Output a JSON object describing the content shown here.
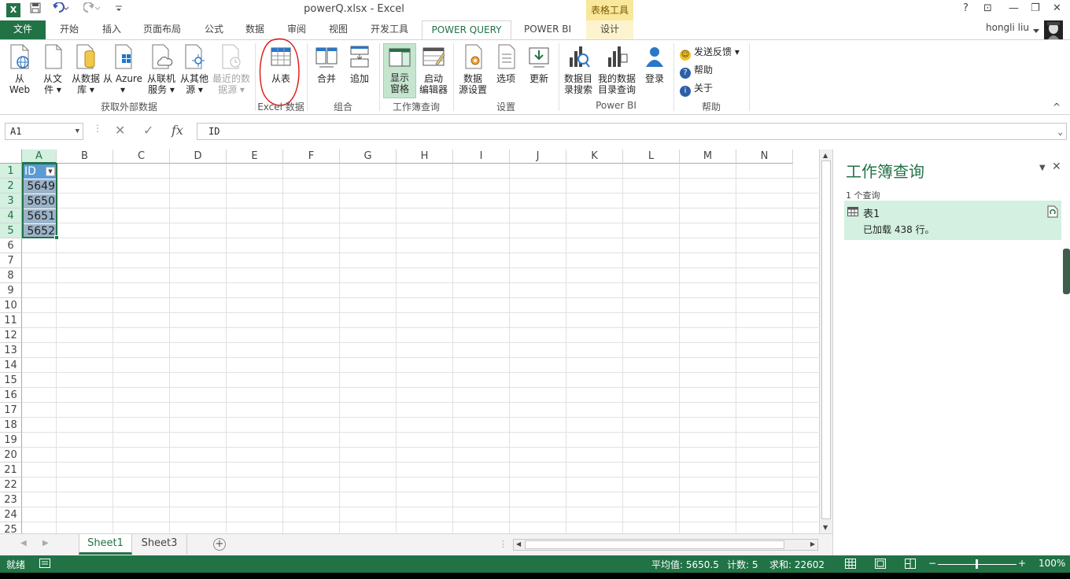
{
  "titlebar": {
    "logo": "X",
    "title": "powerQ.xlsx - Excel",
    "context_tab_group": "表格工具",
    "help": "?",
    "restore_ribbon": "⊡",
    "minimize": "—",
    "maximize": "❐",
    "close": "✕"
  },
  "tabs": {
    "file": "文件",
    "home": "开始",
    "insert": "插入",
    "page_layout": "页面布局",
    "formulas": "公式",
    "data": "数据",
    "review": "审阅",
    "view": "视图",
    "developer": "开发工具",
    "power_query": "POWER QUERY",
    "power_bi": "POWER BI",
    "design": "设计",
    "user": "hongli liu"
  },
  "ribbon": {
    "from_web": [
      "从",
      "Web"
    ],
    "from_file": [
      "从文",
      "件 ▾"
    ],
    "from_database": [
      "从数据",
      "库 ▾"
    ],
    "from_azure": [
      "从 Azure",
      "▾"
    ],
    "from_online_services": [
      "从联机",
      "服务 ▾"
    ],
    "from_other_sources": [
      "从其他",
      "源 ▾"
    ],
    "recent_sources": [
      "最近的数",
      "据源 ▾"
    ],
    "group_external": "获取外部数据",
    "from_table": "从表",
    "group_excel": "Excel 数据",
    "merge": "合并",
    "append": "追加",
    "group_combine": "组合",
    "show_pane": [
      "显示",
      "窗格"
    ],
    "launch_editor": [
      "启动",
      "编辑器"
    ],
    "group_workbook_queries": "工作簿查询",
    "data_source_settings": [
      "数据",
      "源设置"
    ],
    "options": "选项",
    "refresh": "更新",
    "group_settings": "设置",
    "data_catalog_search": [
      "数据目",
      "录搜索"
    ],
    "my_catalog_queries": [
      "我的数据",
      "目录查询"
    ],
    "sign_in": "登录",
    "group_power_bi": "Power BI",
    "send_feedback": "发送反馈 ▾",
    "help": "帮助",
    "about": "关于",
    "group_help": "帮助",
    "collapse": "^"
  },
  "formula_bar": {
    "name_box": "A1",
    "dots": "⋮",
    "cancel": "✕",
    "enter": "✓",
    "fx": "fx",
    "content": "ID"
  },
  "grid": {
    "columns": [
      "A",
      "B",
      "C",
      "D",
      "E",
      "F",
      "G",
      "H",
      "I",
      "J",
      "K",
      "L",
      "M",
      "N"
    ],
    "rows": [
      "1",
      "2",
      "3",
      "4",
      "5",
      "6",
      "7",
      "8",
      "9",
      "10",
      "11",
      "12",
      "13",
      "14",
      "15",
      "16",
      "17",
      "18",
      "19",
      "20",
      "21",
      "22",
      "23",
      "24",
      "25"
    ],
    "table_header": "ID",
    "values": [
      "5649",
      "5650",
      "5651",
      "5652"
    ]
  },
  "sheets": {
    "tabs": [
      "Sheet1",
      "Sheet3"
    ],
    "active": "Sheet1",
    "add": "+"
  },
  "query_pane": {
    "title": "工作簿查询",
    "count": "1 个查询",
    "query_name": "表1",
    "query_status": "已加载 438 行。"
  },
  "statusbar": {
    "ready": "就绪",
    "average": "平均值: 5650.5",
    "count": "计数: 5",
    "sum": "求和: 22602",
    "zoom_minus": "−",
    "zoom_plus": "+",
    "zoom": "100%"
  },
  "colors": {
    "excel_green": "#217346",
    "selection_fill": "#d3f0e0",
    "table_header": "#5b9bd5",
    "annotation_red": "#e0201b"
  }
}
